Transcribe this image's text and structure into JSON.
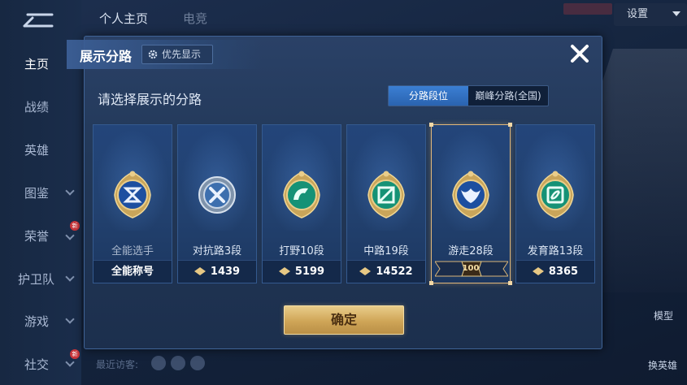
{
  "background": {
    "nav": [
      "主页",
      "战绩",
      "英雄",
      "图鉴",
      "荣誉",
      "护卫队",
      "游戏",
      "社交"
    ],
    "nav_badge": "新",
    "top_tabs": [
      "个人主页",
      "电竞"
    ],
    "settings_label": "设置",
    "recent_visitors_label": "最近访客:",
    "right_buttons": [
      "模型",
      "换英雄"
    ]
  },
  "modal": {
    "title": "展示分路",
    "priority_label": "优先显示",
    "subtitle": "请选择展示的分路",
    "toggle": [
      "分路段位",
      "巅峰分路(全国)"
    ],
    "cards": [
      {
        "name": "全能选手",
        "footer": "全能称号",
        "emblem_color": "#4a8fd8",
        "icon": "all-round-icon"
      },
      {
        "name": "对抗路3段",
        "footer": "1439",
        "emblem_color": "#8fa6bf",
        "icon": "clash-lane-icon"
      },
      {
        "name": "打野10段",
        "footer": "5199",
        "emblem_color": "#1fa58a",
        "icon": "jungle-icon"
      },
      {
        "name": "中路19段",
        "footer": "14522",
        "emblem_color": "#1fa58a",
        "icon": "mid-lane-icon"
      },
      {
        "name": "游走28段",
        "footer": "",
        "emblem_color": "#4a8fd8",
        "icon": "roam-icon",
        "badge": "100"
      },
      {
        "name": "发育路13段",
        "footer": "8365",
        "emblem_color": "#1fa58a",
        "icon": "farm-lane-icon"
      }
    ],
    "confirm_label": "确定"
  }
}
